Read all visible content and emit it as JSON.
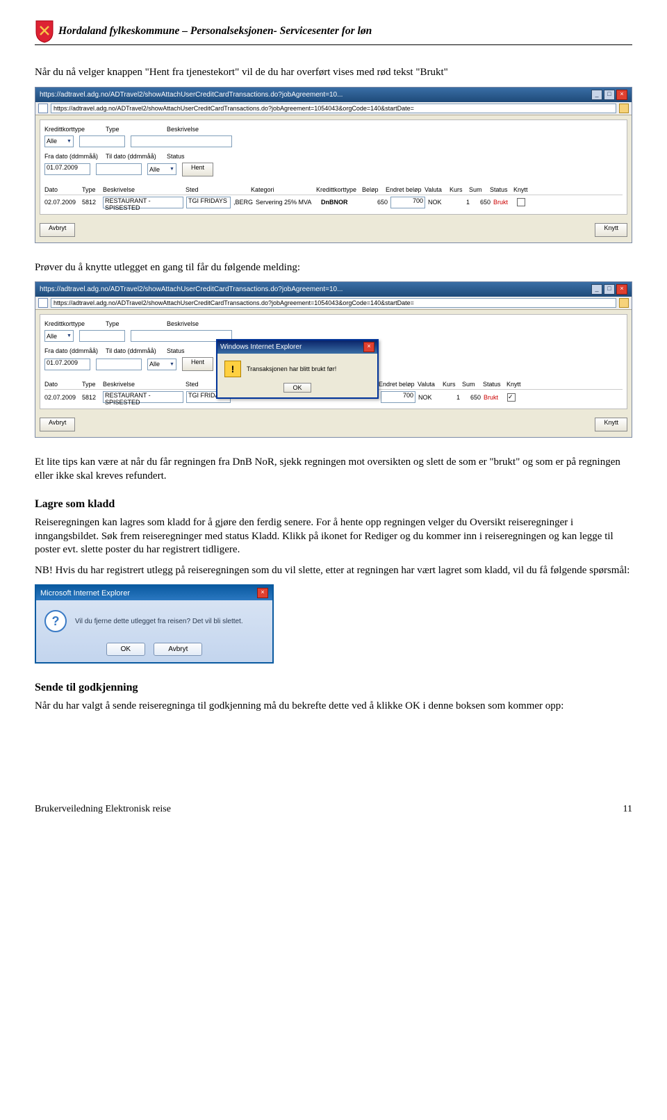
{
  "header": {
    "text": "Hordaland fylkeskommune – Personalseksjonen- Servicesenter for løn"
  },
  "para1": "Når du nå velger knappen \"Hent fra tjenestekort\" vil de du har overført vises med rød tekst \"Brukt\"",
  "screenshot1": {
    "title_url": "https://adtravel.adg.no/ADTravel2/showAttachUserCreditCardTransactions.do?jobAgreement=10...",
    "addr_url": "https://adtravel.adg.no/ADTravel2/showAttachUserCreditCardTransactions.do?jobAgreement=1054043&orgCode=140&startDate=",
    "labels": {
      "korttype": "Kredittkorttype",
      "type": "Type",
      "beskr": "Beskrivelse",
      "fra": "Fra dato (ddmmåå)",
      "til": "Til dato (ddmmåå)",
      "status": "Status"
    },
    "values": {
      "alle": "Alle",
      "dato": "01.07.2009",
      "hent": "Hent",
      "avbryt": "Avbryt",
      "knytt": "Knytt"
    },
    "thead": [
      "Dato",
      "Type",
      "Beskrivelse",
      "Sted",
      "Kategori",
      "Kredittkorttype",
      "Beløp",
      "Endret beløp",
      "Valuta",
      "Kurs",
      "Sum",
      "Status",
      "Knytt"
    ],
    "row": {
      "dato": "02.07.2009",
      "kode": "5812",
      "beskr": "RESTAURANT - SPISESTED",
      "sted": "TGI FRIDAYS",
      "by": ",BERG",
      "kat": "Servering 25% MVA",
      "kort": "DnBNOR",
      "belop": "650",
      "endret": "700",
      "valuta": "NOK",
      "kurs": "1",
      "sum": "650",
      "status": "Brukt"
    }
  },
  "para2": "Prøver du å knytte utlegget en gang til får du følgende melding:",
  "screenshot2": {
    "dialog_title": "Windows Internet Explorer",
    "dialog_msg": "Transaksjonen har blitt brukt før!",
    "ok": "OK"
  },
  "para3": "Et lite tips kan være at når du får regningen fra DnB NoR, sjekk regningen mot oversikten og slett de som er \"brukt\" og som er på regningen eller ikke skal kreves refundert.",
  "section1": "Lagre som kladd",
  "para4": "Reiseregningen kan lagres som kladd for å gjøre den ferdig senere. For å hente opp regningen velger du Oversikt reiseregninger i inngangsbildet. Søk frem reiseregninger med status Kladd. Klikk på ikonet for Rediger og du kommer inn i reiseregningen og kan legge til poster evt. slette poster du har registrert tidligere.",
  "para5": "NB! Hvis du har registrert utlegg på reiseregningen som du vil slette, etter at regningen har vært lagret som kladd, vil du få følgende spørsmål:",
  "ie_dialog": {
    "title": "Microsoft Internet Explorer",
    "msg": "Vil du fjerne dette utlegget fra reisen? Det vil bli slettet.",
    "ok": "OK",
    "avbryt": "Avbryt"
  },
  "section2": "Sende til godkjenning",
  "para6": "Når du har valgt å sende reiseregninga til godkjenning må du bekrefte dette ved å klikke OK i denne boksen som kommer opp:",
  "footer": {
    "left": "Brukerveiledning Elektronisk reise",
    "right": "11"
  }
}
